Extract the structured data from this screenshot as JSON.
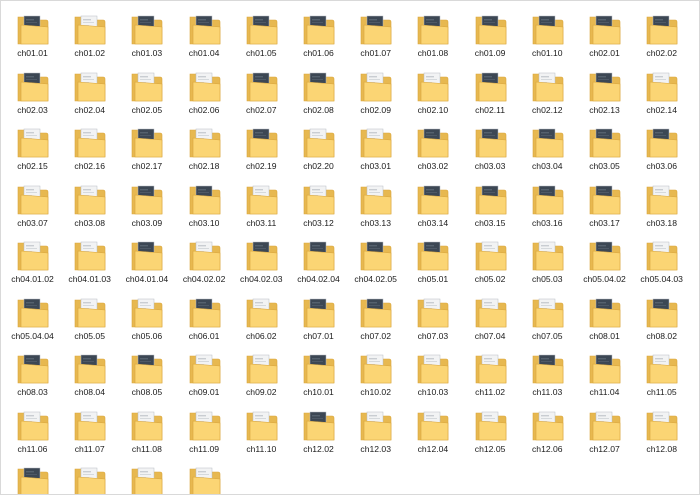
{
  "folders": [
    {
      "name": "ch01.01",
      "thumb": "dark"
    },
    {
      "name": "ch01.02",
      "thumb": "light"
    },
    {
      "name": "ch01.03",
      "thumb": "dark"
    },
    {
      "name": "ch01.04",
      "thumb": "dark"
    },
    {
      "name": "ch01.05",
      "thumb": "dark"
    },
    {
      "name": "ch01.06",
      "thumb": "dark"
    },
    {
      "name": "ch01.07",
      "thumb": "dark"
    },
    {
      "name": "ch01.08",
      "thumb": "dark"
    },
    {
      "name": "ch01.09",
      "thumb": "dark"
    },
    {
      "name": "ch01.10",
      "thumb": "dark"
    },
    {
      "name": "ch02.01",
      "thumb": "dark"
    },
    {
      "name": "ch02.02",
      "thumb": "dark"
    },
    {
      "name": "ch02.03",
      "thumb": "dark"
    },
    {
      "name": "ch02.04",
      "thumb": "light"
    },
    {
      "name": "ch02.05",
      "thumb": "light"
    },
    {
      "name": "ch02.06",
      "thumb": "light"
    },
    {
      "name": "ch02.07",
      "thumb": "dark"
    },
    {
      "name": "ch02.08",
      "thumb": "dark"
    },
    {
      "name": "ch02.09",
      "thumb": "light"
    },
    {
      "name": "ch02.10",
      "thumb": "light"
    },
    {
      "name": "ch02.11",
      "thumb": "dark"
    },
    {
      "name": "ch02.12",
      "thumb": "light"
    },
    {
      "name": "ch02.13",
      "thumb": "dark"
    },
    {
      "name": "ch02.14",
      "thumb": "light"
    },
    {
      "name": "ch02.15",
      "thumb": "light"
    },
    {
      "name": "ch02.16",
      "thumb": "light"
    },
    {
      "name": "ch02.17",
      "thumb": "dark"
    },
    {
      "name": "ch02.18",
      "thumb": "light"
    },
    {
      "name": "ch02.19",
      "thumb": "dark"
    },
    {
      "name": "ch02.20",
      "thumb": "light"
    },
    {
      "name": "ch03.01",
      "thumb": "light"
    },
    {
      "name": "ch03.02",
      "thumb": "dark"
    },
    {
      "name": "ch03.03",
      "thumb": "dark"
    },
    {
      "name": "ch03.04",
      "thumb": "dark"
    },
    {
      "name": "ch03.05",
      "thumb": "dark"
    },
    {
      "name": "ch03.06",
      "thumb": "dark"
    },
    {
      "name": "ch03.07",
      "thumb": "light"
    },
    {
      "name": "ch03.08",
      "thumb": "light"
    },
    {
      "name": "ch03.09",
      "thumb": "dark"
    },
    {
      "name": "ch03.10",
      "thumb": "dark"
    },
    {
      "name": "ch03.11",
      "thumb": "light"
    },
    {
      "name": "ch03.12",
      "thumb": "light"
    },
    {
      "name": "ch03.13",
      "thumb": "light"
    },
    {
      "name": "ch03.14",
      "thumb": "dark"
    },
    {
      "name": "ch03.15",
      "thumb": "dark"
    },
    {
      "name": "ch03.16",
      "thumb": "dark"
    },
    {
      "name": "ch03.17",
      "thumb": "dark"
    },
    {
      "name": "ch03.18",
      "thumb": "light"
    },
    {
      "name": "ch04.01.02",
      "thumb": "light"
    },
    {
      "name": "ch04.01.03",
      "thumb": "light"
    },
    {
      "name": "ch04.01.04",
      "thumb": "dark"
    },
    {
      "name": "ch04.02.02",
      "thumb": "light"
    },
    {
      "name": "ch04.02.03",
      "thumb": "dark"
    },
    {
      "name": "ch04.02.04",
      "thumb": "dark"
    },
    {
      "name": "ch04.02.05",
      "thumb": "dark"
    },
    {
      "name": "ch05.01",
      "thumb": "dark"
    },
    {
      "name": "ch05.02",
      "thumb": "light"
    },
    {
      "name": "ch05.03",
      "thumb": "light"
    },
    {
      "name": "ch05.04.02",
      "thumb": "dark"
    },
    {
      "name": "ch05.04.03",
      "thumb": "light"
    },
    {
      "name": "ch05.04.04",
      "thumb": "dark"
    },
    {
      "name": "ch05.05",
      "thumb": "light"
    },
    {
      "name": "ch05.06",
      "thumb": "light"
    },
    {
      "name": "ch06.01",
      "thumb": "dark"
    },
    {
      "name": "ch06.02",
      "thumb": "light"
    },
    {
      "name": "ch07.01",
      "thumb": "dark"
    },
    {
      "name": "ch07.02",
      "thumb": "dark"
    },
    {
      "name": "ch07.03",
      "thumb": "light"
    },
    {
      "name": "ch07.04",
      "thumb": "light"
    },
    {
      "name": "ch07.05",
      "thumb": "light"
    },
    {
      "name": "ch08.01",
      "thumb": "dark"
    },
    {
      "name": "ch08.02",
      "thumb": "dark"
    },
    {
      "name": "ch08.03",
      "thumb": "dark"
    },
    {
      "name": "ch08.04",
      "thumb": "dark"
    },
    {
      "name": "ch08.05",
      "thumb": "dark"
    },
    {
      "name": "ch09.01",
      "thumb": "light"
    },
    {
      "name": "ch09.02",
      "thumb": "light"
    },
    {
      "name": "ch10.01",
      "thumb": "dark"
    },
    {
      "name": "ch10.02",
      "thumb": "light"
    },
    {
      "name": "ch10.03",
      "thumb": "light"
    },
    {
      "name": "ch11.02",
      "thumb": "light"
    },
    {
      "name": "ch11.03",
      "thumb": "dark"
    },
    {
      "name": "ch11.04",
      "thumb": "dark"
    },
    {
      "name": "ch11.05",
      "thumb": "light"
    },
    {
      "name": "ch11.06",
      "thumb": "light"
    },
    {
      "name": "ch11.07",
      "thumb": "light"
    },
    {
      "name": "ch11.08",
      "thumb": "light"
    },
    {
      "name": "ch11.09",
      "thumb": "light"
    },
    {
      "name": "ch11.10",
      "thumb": "light"
    },
    {
      "name": "ch12.02",
      "thumb": "dark"
    },
    {
      "name": "ch12.03",
      "thumb": "light"
    },
    {
      "name": "ch12.04",
      "thumb": "light"
    },
    {
      "name": "ch12.05",
      "thumb": "light"
    },
    {
      "name": "ch12.06",
      "thumb": "light"
    },
    {
      "name": "ch12.07",
      "thumb": "light"
    },
    {
      "name": "ch12.08",
      "thumb": "light"
    },
    {
      "name": "",
      "thumb": "dark"
    },
    {
      "name": "",
      "thumb": "light"
    },
    {
      "name": "",
      "thumb": "light"
    },
    {
      "name": "",
      "thumb": "light"
    }
  ],
  "colors": {
    "folder_back": "#e7b850",
    "folder_front": "#fbd574",
    "folder_edge": "#d9a53c",
    "thumb_dark": "#3c4754",
    "thumb_light": "#f2f3f4",
    "label_text": "#1b1b1b"
  }
}
